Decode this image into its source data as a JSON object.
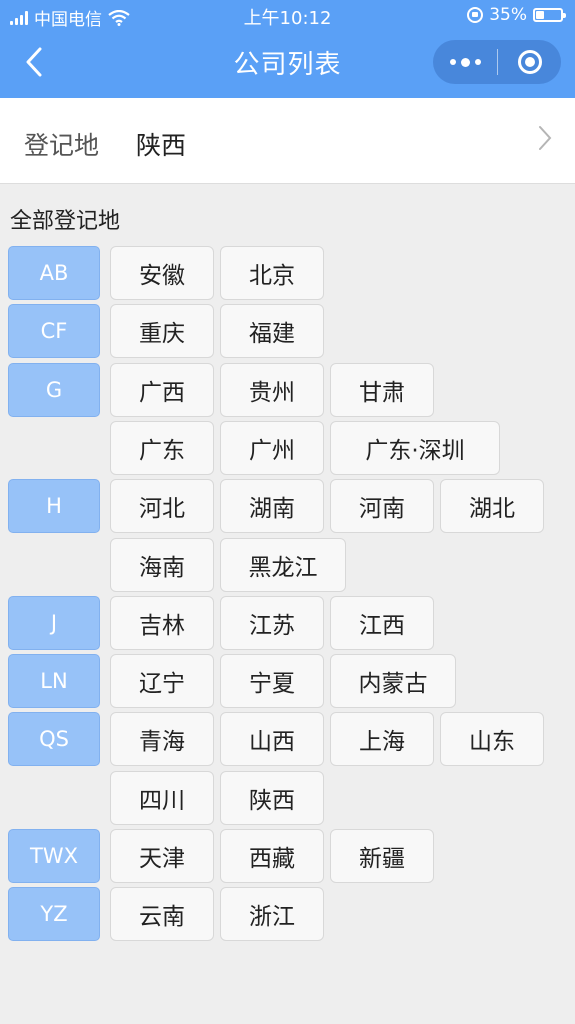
{
  "status_bar": {
    "carrier": "中国电信",
    "time": "上午10:12",
    "battery_text": "35%",
    "battery_level": 0.35
  },
  "nav": {
    "title": "公司列表"
  },
  "registration": {
    "label": "登记地",
    "value": "陕西"
  },
  "section_title": "全部登记地",
  "groups": [
    {
      "letter": "AB",
      "rows": [
        [
          "安徽",
          "北京"
        ]
      ]
    },
    {
      "letter": "CF",
      "rows": [
        [
          "重庆",
          "福建"
        ]
      ]
    },
    {
      "letter": "G",
      "rows": [
        [
          "广西",
          "贵州",
          "甘肃"
        ],
        [
          "广东",
          "广州",
          "广东·深圳"
        ]
      ]
    },
    {
      "letter": "H",
      "rows": [
        [
          "河北",
          "湖南",
          "河南",
          "湖北"
        ],
        [
          "海南",
          "黑龙江"
        ]
      ]
    },
    {
      "letter": "J",
      "rows": [
        [
          "吉林",
          "江苏",
          "江西"
        ]
      ]
    },
    {
      "letter": "LN",
      "rows": [
        [
          "辽宁",
          "宁夏",
          "内蒙古"
        ]
      ]
    },
    {
      "letter": "QS",
      "rows": [
        [
          "青海",
          "山西",
          "上海",
          "山东"
        ],
        [
          "四川",
          "陕西"
        ]
      ]
    },
    {
      "letter": "TWX",
      "rows": [
        [
          "天津",
          "西藏",
          "新疆"
        ]
      ]
    },
    {
      "letter": "YZ",
      "rows": [
        [
          "云南",
          "浙江"
        ]
      ]
    }
  ],
  "colors": {
    "header": "#5aa0f6",
    "letter_chip": "#97c2f8",
    "background": "#eeeeee"
  }
}
